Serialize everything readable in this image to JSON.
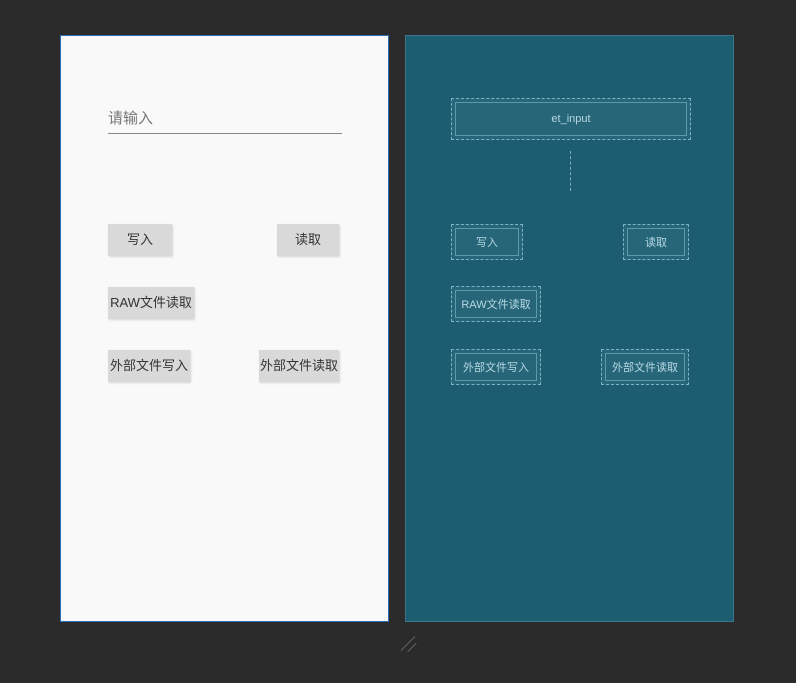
{
  "left": {
    "input_placeholder": "请输入",
    "buttons": {
      "write": "写入",
      "read": "读取",
      "raw_read": "RAW文件读取",
      "ext_write": "外部文件写入",
      "ext_read": "外部文件读取"
    }
  },
  "right": {
    "input_label": "et_input",
    "buttons": {
      "write": "写入",
      "read": "读取",
      "raw_read": "RAW文件读取",
      "ext_write": "外部文件写入",
      "ext_read": "外部文件读取"
    }
  }
}
